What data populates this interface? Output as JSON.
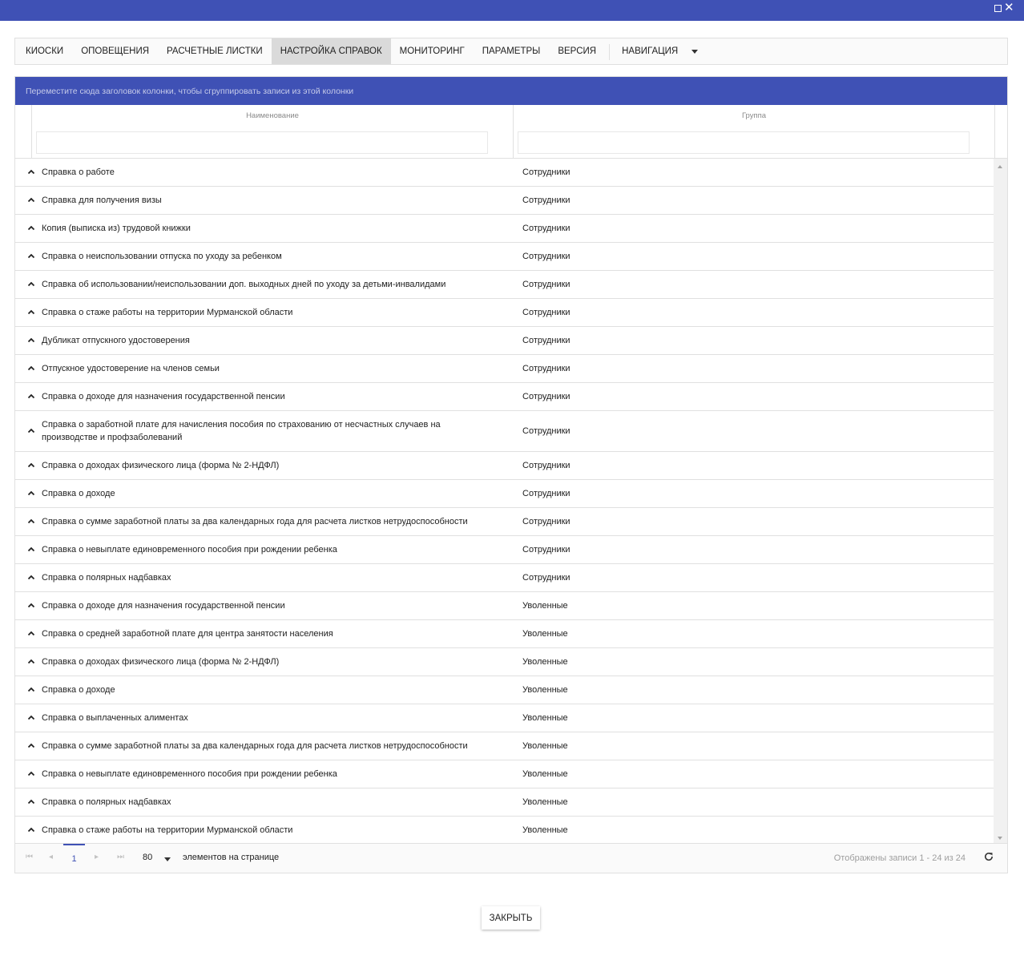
{
  "tabs": [
    {
      "label": "КИОСКИ"
    },
    {
      "label": "ОПОВЕЩЕНИЯ"
    },
    {
      "label": "РАСЧЕТНЫЕ ЛИСТКИ"
    },
    {
      "label": "НАСТРОЙКА СПРАВОК"
    },
    {
      "label": "МОНИТОРИНГ"
    },
    {
      "label": "ПАРАМЕТРЫ"
    },
    {
      "label": "ВЕРСИЯ"
    },
    {
      "label": "НАВИГАЦИЯ"
    }
  ],
  "active_tab": "НАСТРОЙКА СПРАВОК",
  "grid": {
    "group_panel_text": "Переместите сюда заголовок колонки, чтобы сгруппировать записи из этой колонки",
    "columns": {
      "name": "Наименование",
      "group": "Группа"
    },
    "rows": [
      {
        "name": "Справка о работе",
        "group": "Сотрудники"
      },
      {
        "name": "Справка для получения визы",
        "group": "Сотрудники"
      },
      {
        "name": "Копия (выписка из) трудовой книжки",
        "group": "Сотрудники"
      },
      {
        "name": "Справка о неиспользовании отпуска по уходу за ребенком",
        "group": "Сотрудники"
      },
      {
        "name": "Справка об использовании/неиспользовании доп. выходных дней по уходу за детьми-инвалидами",
        "group": "Сотрудники"
      },
      {
        "name": "Справка о стаже работы на территории Мурманской области",
        "group": "Сотрудники"
      },
      {
        "name": "Дубликат отпускного удостоверения",
        "group": "Сотрудники"
      },
      {
        "name": "Отпускное удостоверение на членов семьи",
        "group": "Сотрудники"
      },
      {
        "name": "Справка о доходе для назначения государственной пенсии",
        "group": "Сотрудники"
      },
      {
        "name": "Справка о заработной плате для начисления пособия по страхованию от несчастных случаев на производстве и профзаболеваний",
        "group": "Сотрудники",
        "tall": true
      },
      {
        "name": "Справка о доходах физического лица (форма № 2-НДФЛ)",
        "group": "Сотрудники"
      },
      {
        "name": "Справка о доходе",
        "group": "Сотрудники"
      },
      {
        "name": "Справка о сумме заработной платы за два календарных года для расчета листков нетрудоспособности",
        "group": "Сотрудники"
      },
      {
        "name": "Справка о невыплате единовременного пособия при рождении ребенка",
        "group": "Сотрудники"
      },
      {
        "name": "Справка о полярных надбавках",
        "group": "Сотрудники"
      },
      {
        "name": "Справка о доходе для назначения государственной пенсии",
        "group": "Уволенные"
      },
      {
        "name": "Справка о средней заработной плате для центра занятости населения",
        "group": "Уволенные"
      },
      {
        "name": "Справка о доходах физического лица (форма № 2-НДФЛ)",
        "group": "Уволенные"
      },
      {
        "name": "Справка о доходе",
        "group": "Уволенные"
      },
      {
        "name": "Справка о выплаченных алиментах",
        "group": "Уволенные"
      },
      {
        "name": "Справка о сумме заработной платы за два календарных года для расчета листков нетрудоспособности",
        "group": "Уволенные"
      },
      {
        "name": "Справка о невыплате единовременного пособия при рождении ребенка",
        "group": "Уволенные"
      },
      {
        "name": "Справка о полярных надбавках",
        "group": "Уволенные"
      },
      {
        "name": "Справка о стаже работы на территории Мурманской области",
        "group": "Уволенные"
      }
    ]
  },
  "pager": {
    "current_page": "1",
    "page_size": "80",
    "page_size_label": "элементов на странице",
    "info": "Отображены записи 1 - 24 из 24"
  },
  "close_button": "ЗАКРЫТЬ",
  "colors": {
    "accent": "#3f51b5",
    "active_tab_bg": "#dadada"
  }
}
